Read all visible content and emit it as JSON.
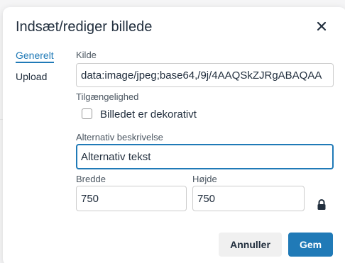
{
  "dialog": {
    "title": "Indsæt/rediger billede"
  },
  "tabs": [
    {
      "label": "Generelt",
      "active": true
    },
    {
      "label": "Upload",
      "active": false
    }
  ],
  "fields": {
    "source": {
      "label": "Kilde",
      "value": "data:image/jpeg;base64,/9j/4AAQSkZJRgABAQAA"
    },
    "accessibility": {
      "label": "Tilgængelighed",
      "checkbox_label": "Billedet er dekorativt",
      "checked": false
    },
    "alt": {
      "label": "Alternativ beskrivelse",
      "value": "Alternativ tekst"
    },
    "width": {
      "label": "Bredde",
      "value": "750"
    },
    "height": {
      "label": "Højde",
      "value": "750"
    }
  },
  "buttons": {
    "cancel": "Annuller",
    "save": "Gem"
  },
  "colors": {
    "accent": "#207ab7",
    "text": "#222f3e"
  },
  "icons": {
    "close": "close-icon",
    "lock": "lock-icon"
  }
}
